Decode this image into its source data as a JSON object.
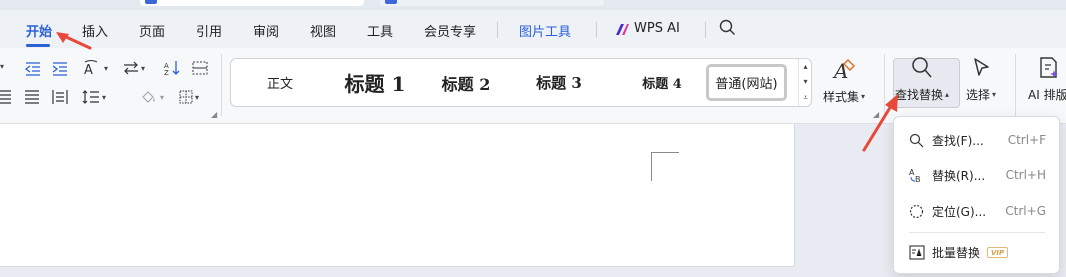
{
  "menu_tabs": [
    {
      "label": "开始",
      "active": true
    },
    {
      "label": "插入"
    },
    {
      "label": "页面"
    },
    {
      "label": "引用"
    },
    {
      "label": "审阅"
    },
    {
      "label": "视图"
    },
    {
      "label": "工具"
    },
    {
      "label": "会员专享"
    },
    {
      "label": "图片工具",
      "highlight": true
    },
    {
      "label": "WPS AI"
    }
  ],
  "styles": {
    "normal": "正文",
    "heading1": "标题 1",
    "heading2": "标题 2",
    "heading3": "标题 3",
    "heading4": "标题 4",
    "web": "普通(网站)",
    "style_set_label": "样式集"
  },
  "buttons": {
    "find_replace": "查找替换",
    "select": "选择",
    "ai_layout": "AI 排版"
  },
  "find_menu": [
    {
      "label": "查找(F)...",
      "shortcut": "Ctrl+F",
      "icon": "search-icon"
    },
    {
      "label": "替换(R)...",
      "shortcut": "Ctrl+H",
      "icon": "replace-icon"
    },
    {
      "label": "定位(G)...",
      "shortcut": "Ctrl+G",
      "icon": "locate-icon"
    },
    {
      "label": "批量替换",
      "badge": "VIP",
      "icon": "batch-replace-icon"
    }
  ],
  "colors": {
    "accent": "#2b60d8",
    "annotation": "#e8483a"
  }
}
